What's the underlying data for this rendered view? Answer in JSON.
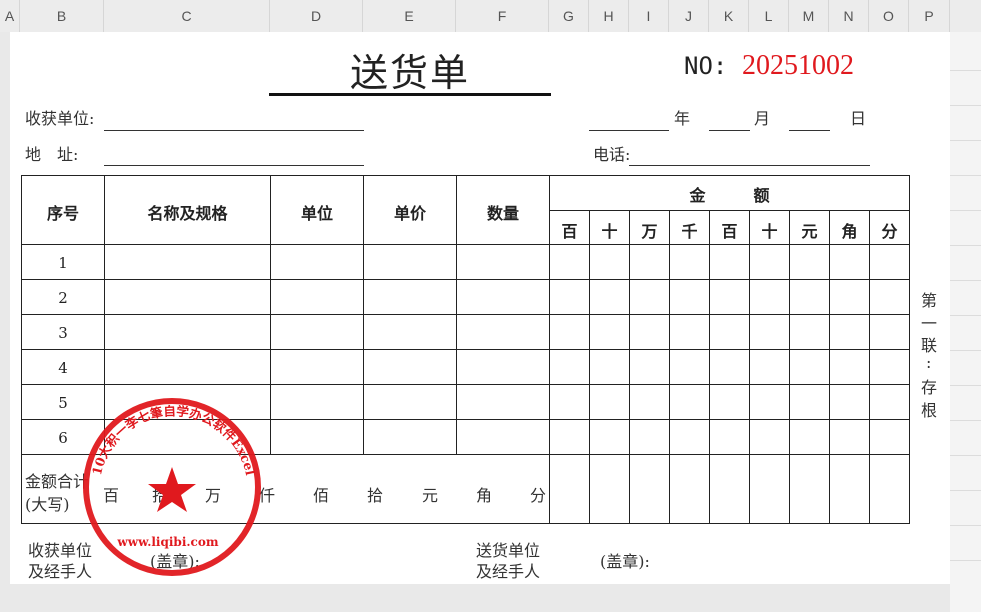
{
  "columns": [
    "A",
    "B",
    "C",
    "D",
    "E",
    "F",
    "G",
    "H",
    "I",
    "J",
    "K",
    "L",
    "M",
    "N",
    "O",
    "P"
  ],
  "form": {
    "title": "送货单",
    "no_label": "NO:",
    "no_value": "20251002",
    "no_color": "#e0191e",
    "receiver_label": "收获单位:",
    "address_label": "地　址:",
    "year_label": "年",
    "month_label": "月",
    "day_label": "日",
    "phone_label": "电话:"
  },
  "table": {
    "headers": {
      "seq": "序号",
      "name": "名称及规格",
      "unit": "单位",
      "price": "单价",
      "qty": "数量",
      "amount": "金　　　额"
    },
    "amount_digits": [
      "百",
      "十",
      "万",
      "千",
      "百",
      "十",
      "元",
      "角",
      "分"
    ],
    "row_numbers": [
      "1",
      "2",
      "3",
      "4",
      "5",
      "6"
    ],
    "total_label_1": "金额合计",
    "total_label_2": "(大写)",
    "total_units": [
      "百",
      "拾",
      "万",
      "仟",
      "佰",
      "拾",
      "元",
      "角",
      "分"
    ]
  },
  "footer": {
    "receiver_1": "收获单位",
    "receiver_2": "及经手人",
    "seal_left": "(盖章):",
    "sender_1": "送货单位",
    "sender_2": "及经手人",
    "seal_right": "(盖章):"
  },
  "side_text": [
    "第",
    "一",
    "联",
    ":",
    "存",
    "根"
  ],
  "stamp": {
    "ring_text": "10大积一李七筆自学办公软件Excel",
    "url": "www.liqibi.com",
    "color": "#e0191e"
  }
}
